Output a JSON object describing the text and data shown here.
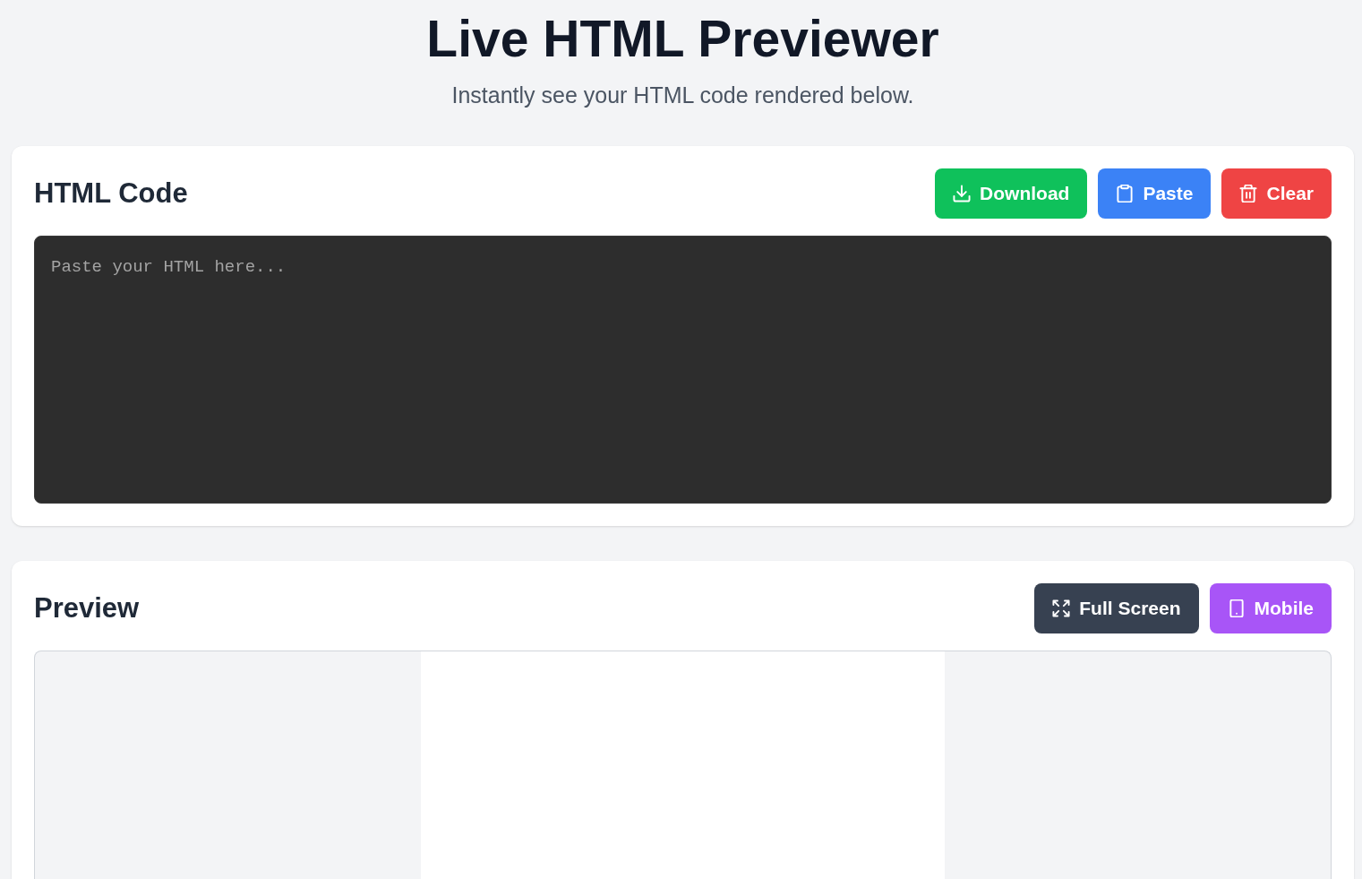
{
  "header": {
    "title": "Live HTML Previewer",
    "subtitle": "Instantly see your HTML code rendered below."
  },
  "editor_panel": {
    "title": "HTML Code",
    "buttons": [
      {
        "kind": "download",
        "label": "Download"
      },
      {
        "kind": "paste",
        "label": "Paste"
      },
      {
        "kind": "clear",
        "label": "Clear"
      }
    ],
    "code_input": {
      "placeholder": "Paste your HTML here..."
    }
  },
  "preview_panel": {
    "title": "Preview",
    "buttons": [
      {
        "kind": "fullscreen",
        "label": "Full Screen"
      },
      {
        "kind": "mobile",
        "label": "Mobile"
      }
    ],
    "viewport": {
      "kind": "mobile"
    }
  }
}
